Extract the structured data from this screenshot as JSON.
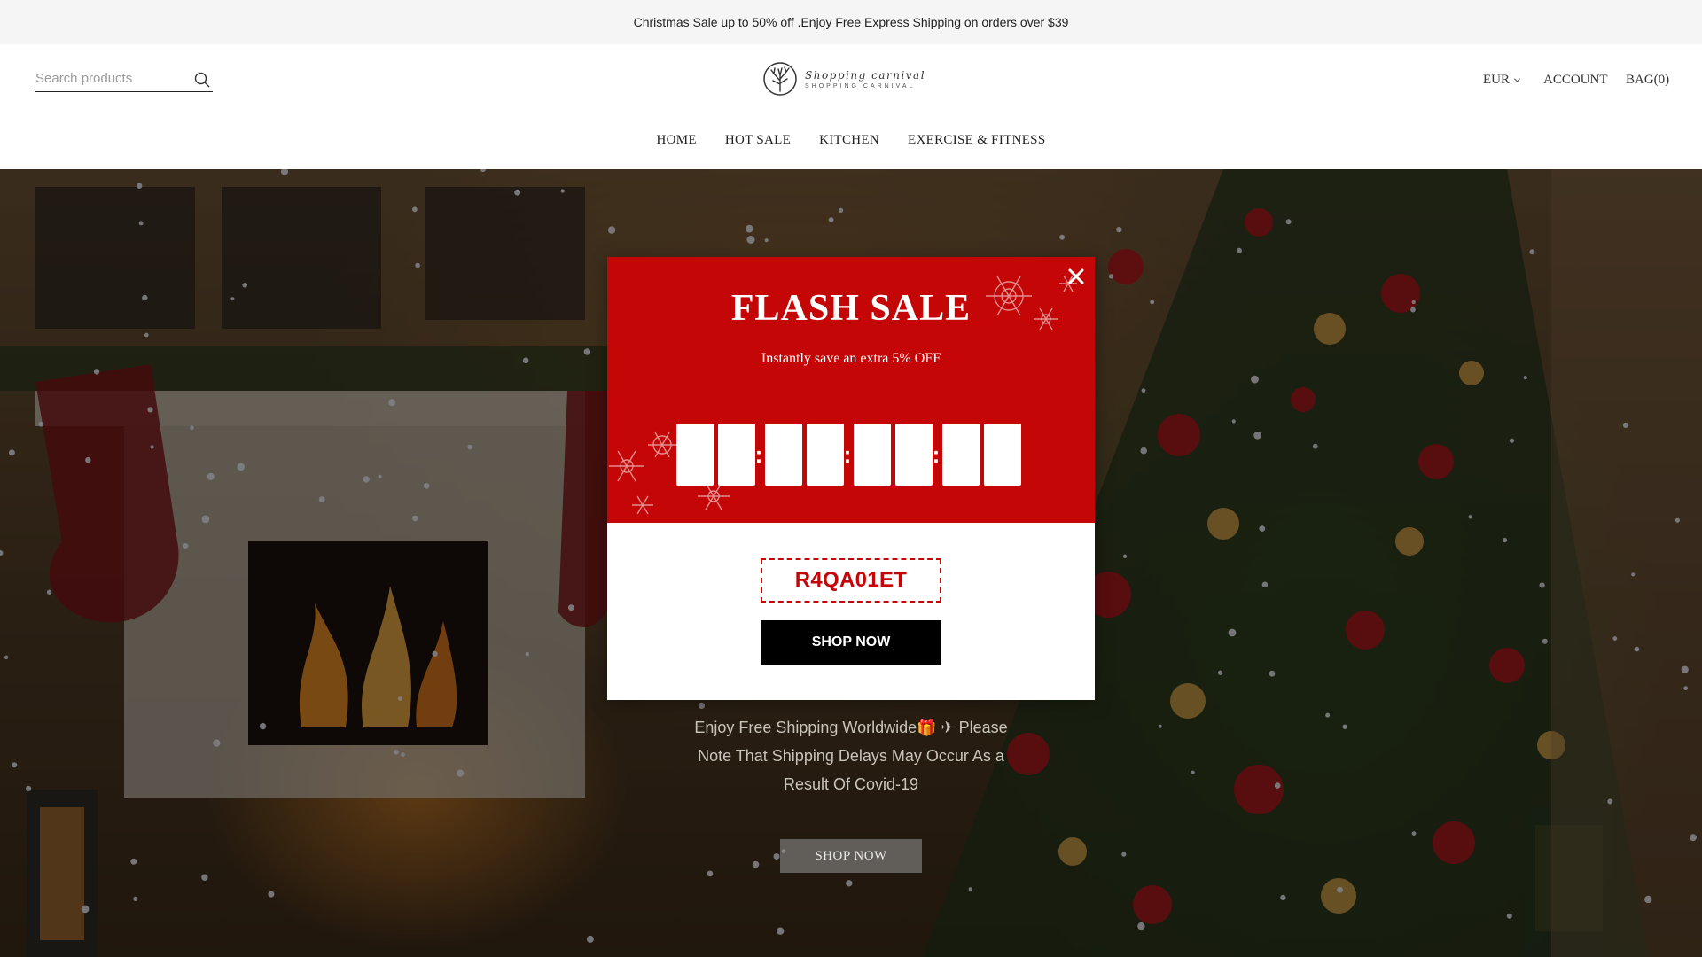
{
  "announcement": {
    "text": "Christmas Sale up to 50% off .Enjoy Free Express Shipping on orders over $39"
  },
  "header": {
    "search_placeholder": "Search products",
    "logo": {
      "main": "Shopping carnival",
      "sub": "SHOPPING CARNIVAL"
    },
    "currency": "EUR",
    "account": "ACCOUNT",
    "bag": "BAG(0)"
  },
  "nav": {
    "items": [
      {
        "label": "HOME"
      },
      {
        "label": "HOT SALE"
      },
      {
        "label": "KITCHEN"
      },
      {
        "label": "EXERCISE & FITNESS"
      }
    ]
  },
  "hero": {
    "text": "Enjoy Free Shipping Worldwide🎁 ✈ Please Note That Shipping Delays May Occur As a Result Of Covid-19",
    "button": "SHOP NOW"
  },
  "popup": {
    "title": "FLASH SALE",
    "subtitle": "Instantly save an extra 5% OFF",
    "timer_digits": [
      "",
      "",
      "",
      "",
      "",
      "",
      "",
      ""
    ],
    "coupon_code": "R4QA01ET",
    "button": "SHOP NOW",
    "accent_color": "#c40606"
  },
  "icons": {
    "search": "search-icon",
    "currency_chevron": "chevron-down-icon",
    "close": "close-icon",
    "logo": "tree-logo-icon"
  }
}
